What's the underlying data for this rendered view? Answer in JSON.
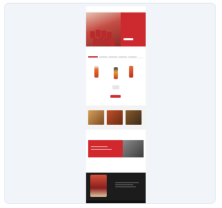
{
  "colors": {
    "card_bg": "#f1f4f8",
    "brand_red": "#cc2a2f",
    "dark_band": "#1c1c1c"
  },
  "thumbnail": {
    "hero": {
      "text_lines": [
        "",
        "",
        ""
      ],
      "button_label": ""
    },
    "products": {
      "heading": "",
      "tabs": [
        "",
        "",
        "",
        "",
        ""
      ],
      "view_all_label": ""
    },
    "recipes": {
      "heading": ""
    },
    "promo": {
      "heading": ""
    },
    "showcase": {
      "heading": ""
    }
  }
}
